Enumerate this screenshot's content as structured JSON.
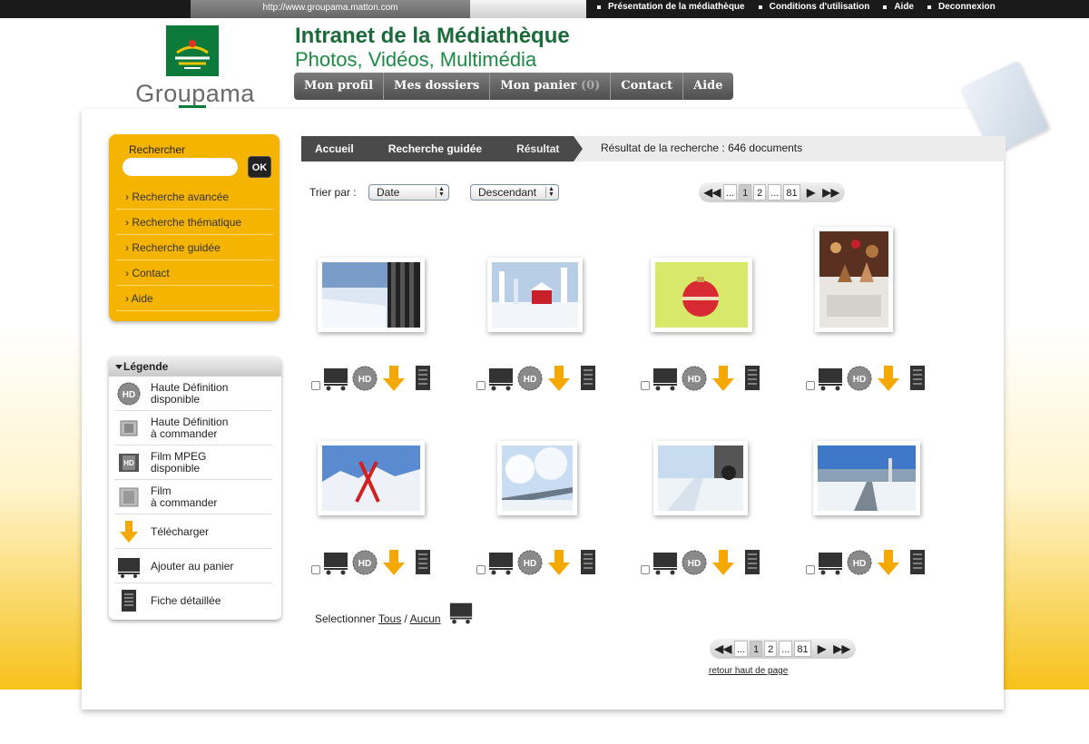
{
  "topbar": {
    "url_text": "http://www.groupama.matton.com",
    "links": [
      "Présentation de la médiathèque",
      "Conditions d'utilisation",
      "Aide",
      "Deconnexion"
    ]
  },
  "brand": {
    "logo_text": "Groupama",
    "title": "Intranet de la Médiathèque",
    "subtitle": "Photos, Vidéos, Multimédia"
  },
  "mainnav": {
    "profile": "Mon profil",
    "folders": "Mes dossiers",
    "cart": "Mon panier",
    "cart_count": "(0)",
    "contact": "Contact",
    "help": "Aide"
  },
  "search": {
    "label": "Rechercher",
    "placeholder": "",
    "button": "OK",
    "links": [
      "Recherche avancée",
      "Recherche thématique",
      "Recherche guidée",
      "Contact",
      "Aide"
    ]
  },
  "legend": {
    "title": "Légende",
    "items": [
      {
        "icon": "hd-badge-icon",
        "label": "Haute Définition\ndisponible"
      },
      {
        "icon": "hd-order-icon",
        "label": "Haute Définition\nà commander"
      },
      {
        "icon": "film-hd-icon",
        "label": "Film MPEG\ndisponible"
      },
      {
        "icon": "film-order-icon",
        "label": "Film\nà commander"
      },
      {
        "icon": "download-arrow-icon",
        "label": "Télécharger"
      },
      {
        "icon": "cart-icon",
        "label": "Ajouter au panier"
      },
      {
        "icon": "detail-sheet-icon",
        "label": "Fiche détaillée"
      }
    ]
  },
  "breadcrumb": {
    "items": [
      "Accueil",
      "Recherche guidée",
      "Résultat"
    ],
    "result_text": "Résultat de la recherche : 646 documents"
  },
  "sort": {
    "label": "Trier par :",
    "field": "Date",
    "order": "Descendant"
  },
  "pagination": {
    "ellipsis": "...",
    "page1": "1",
    "page2": "2",
    "last": "81",
    "first_icon": "first-page-icon",
    "prev_icon": "prev-page-icon",
    "next_icon": "next-page-icon",
    "last_icon": "last-page-icon"
  },
  "results": [
    {
      "subject": "winter tyre on snowy road"
    },
    {
      "subject": "red cabin in snowy forest"
    },
    {
      "subject": "red christmas bauble"
    },
    {
      "subject": "christmas cookies and decorations"
    },
    {
      "subject": "skis crossed in snow"
    },
    {
      "subject": "frosted trees along road"
    },
    {
      "subject": "car on snowy road"
    },
    {
      "subject": "snowy country road"
    }
  ],
  "selection": {
    "prefix": "Selectionner",
    "all": "Tous",
    "separator": "/",
    "none": "Aucun"
  },
  "footer": {
    "back_to_top": "retour haut de page"
  },
  "colors": {
    "brand_green": "#1b6b3a",
    "accent_yellow": "#f5b400",
    "nav_dark": "#4a4a4a",
    "download_orange": "#f5a800"
  }
}
